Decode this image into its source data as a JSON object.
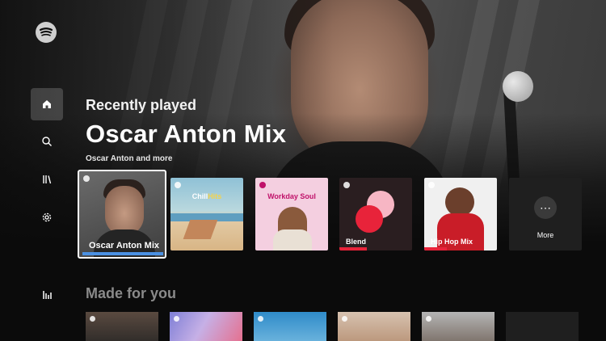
{
  "hero": {
    "image": "artist-portrait"
  },
  "sidebar": {
    "logo": "spotify-logo",
    "items": [
      {
        "icon": "home-icon",
        "active": true
      },
      {
        "icon": "search-icon",
        "active": false
      },
      {
        "icon": "library-icon",
        "active": false
      },
      {
        "icon": "settings-icon",
        "active": false
      },
      {
        "icon": "stats-icon",
        "active": false
      }
    ]
  },
  "main": {
    "section_title": "Recently played",
    "featured_title": "Oscar Anton Mix",
    "featured_subtitle": "Oscar Anton and more",
    "cards": [
      {
        "label": "Oscar Anton Mix",
        "focused": true
      },
      {
        "label": "Chill Hits",
        "label_parts": [
          "Chill",
          "Hits"
        ]
      },
      {
        "label": "Workday Soul"
      },
      {
        "label": "Blend"
      },
      {
        "label": "Hip Hop Mix"
      },
      {
        "label": "More"
      }
    ],
    "made_for_you_title": "Made for you"
  },
  "colors": {
    "accent": "#e8233a",
    "focus": "#ffffff",
    "progress": "#4a90e2"
  }
}
